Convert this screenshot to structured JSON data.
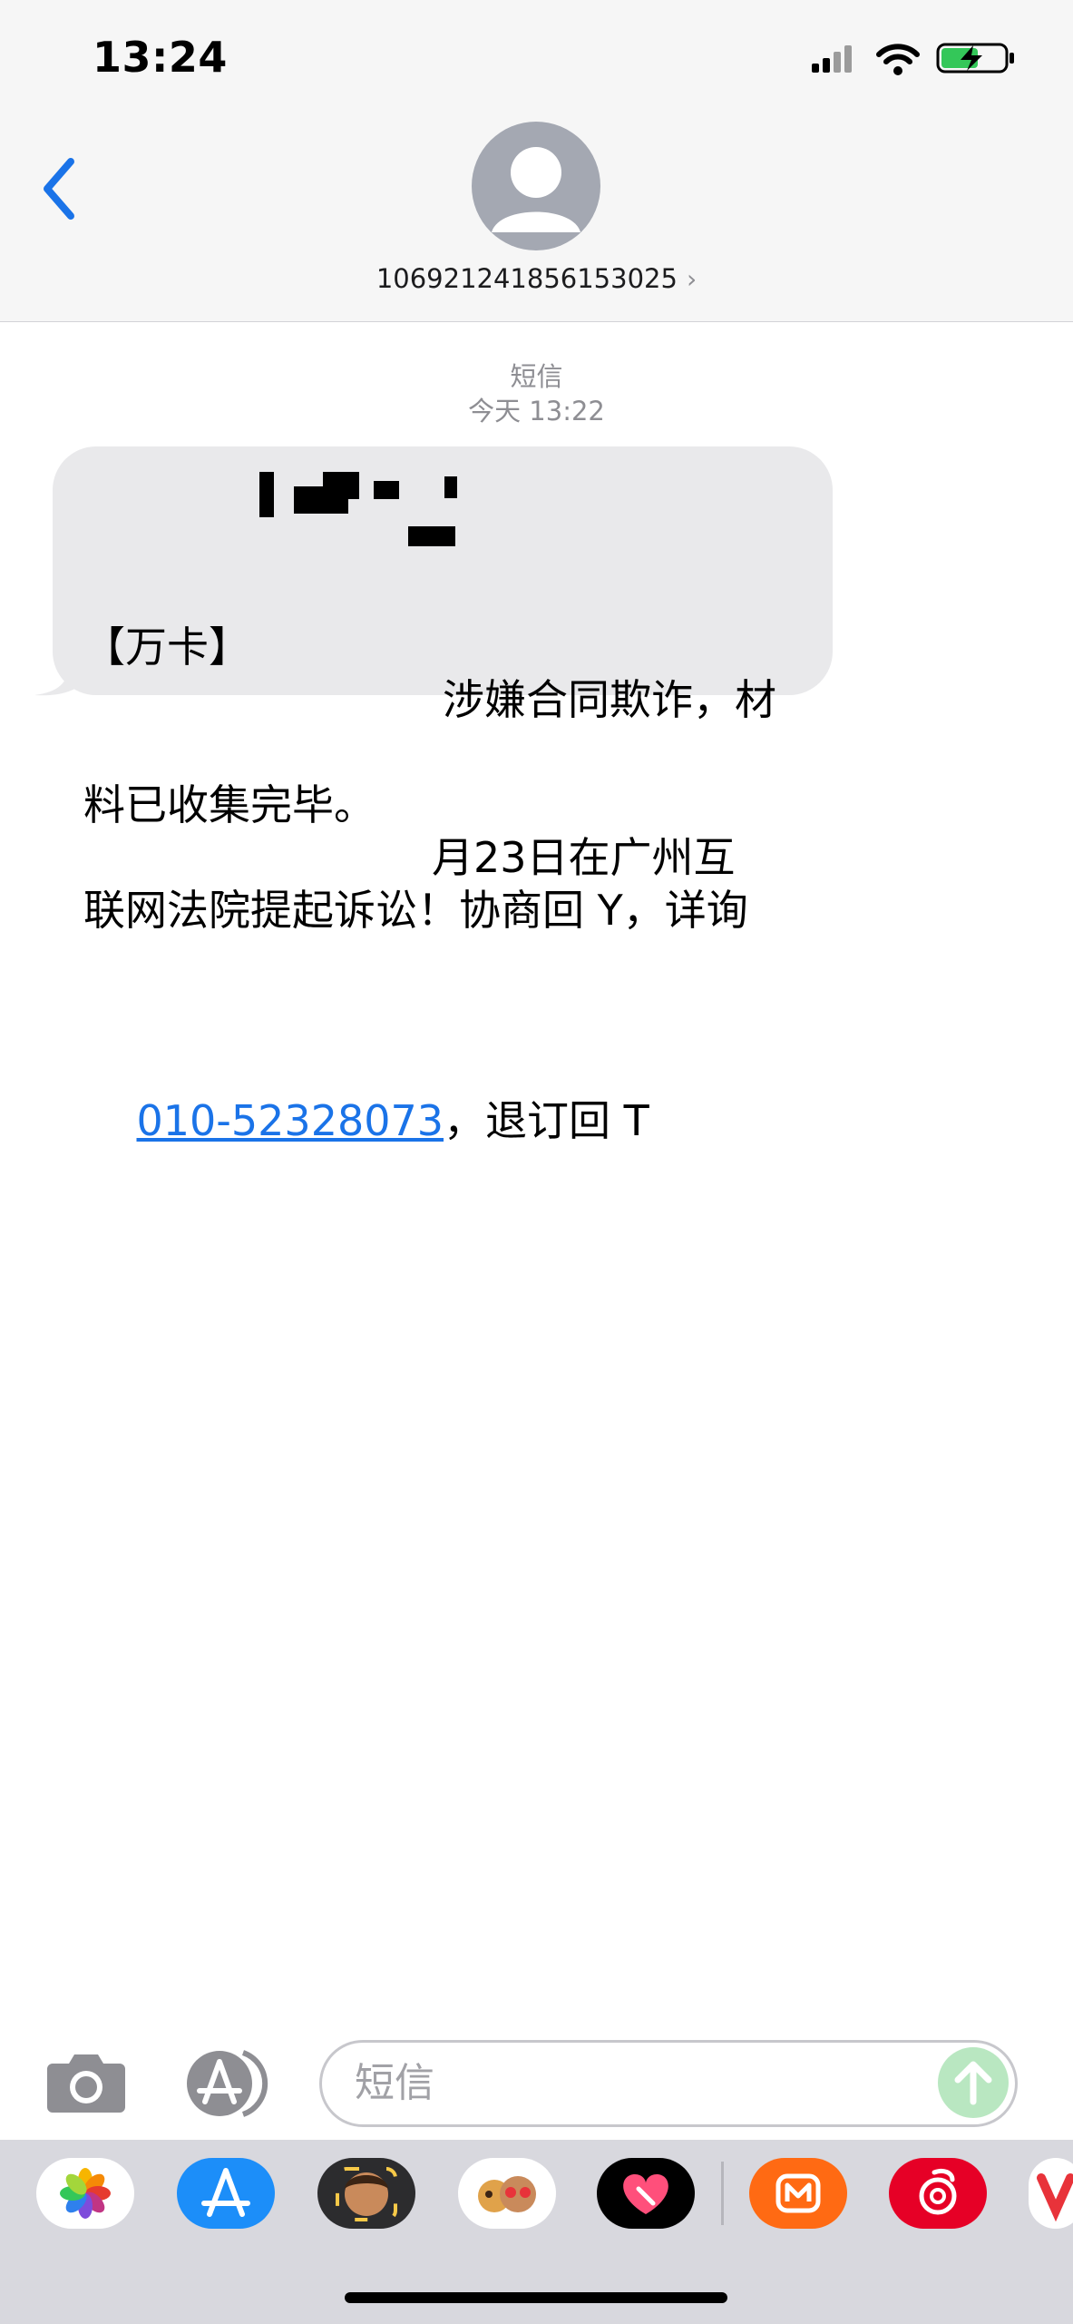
{
  "status": {
    "time": "13:24"
  },
  "header": {
    "contact_number": "106921241856153025",
    "chevron": "›"
  },
  "conversation": {
    "service_label": "短信",
    "timestamp": "今天 13:22",
    "message": {
      "line1": "【万卡】",
      "line1b": "涉嫌合同欺诈，材",
      "line2a": "料已收集完毕。",
      "line2b": "月23日在广州互",
      "line3": "联网法院提起诉讼！协商回 Y，详询",
      "phone_link": "010-52328073",
      "line4_tail": "，退订回 T"
    }
  },
  "composer": {
    "placeholder": "短信"
  },
  "dock": {
    "apps": [
      "photos-icon",
      "app-store-icon",
      "memoji-icon",
      "memoji-stickers-icon",
      "heart-app-icon",
      "mango-tv-icon",
      "netease-music-icon",
      "red-app-icon"
    ]
  },
  "colors": {
    "accent": "#1a73e8",
    "bubble": "#e9e9eb",
    "header_bg": "#f6f6f6",
    "dock_bg": "#d8d8de",
    "send_disabled": "#b9e7c1"
  }
}
